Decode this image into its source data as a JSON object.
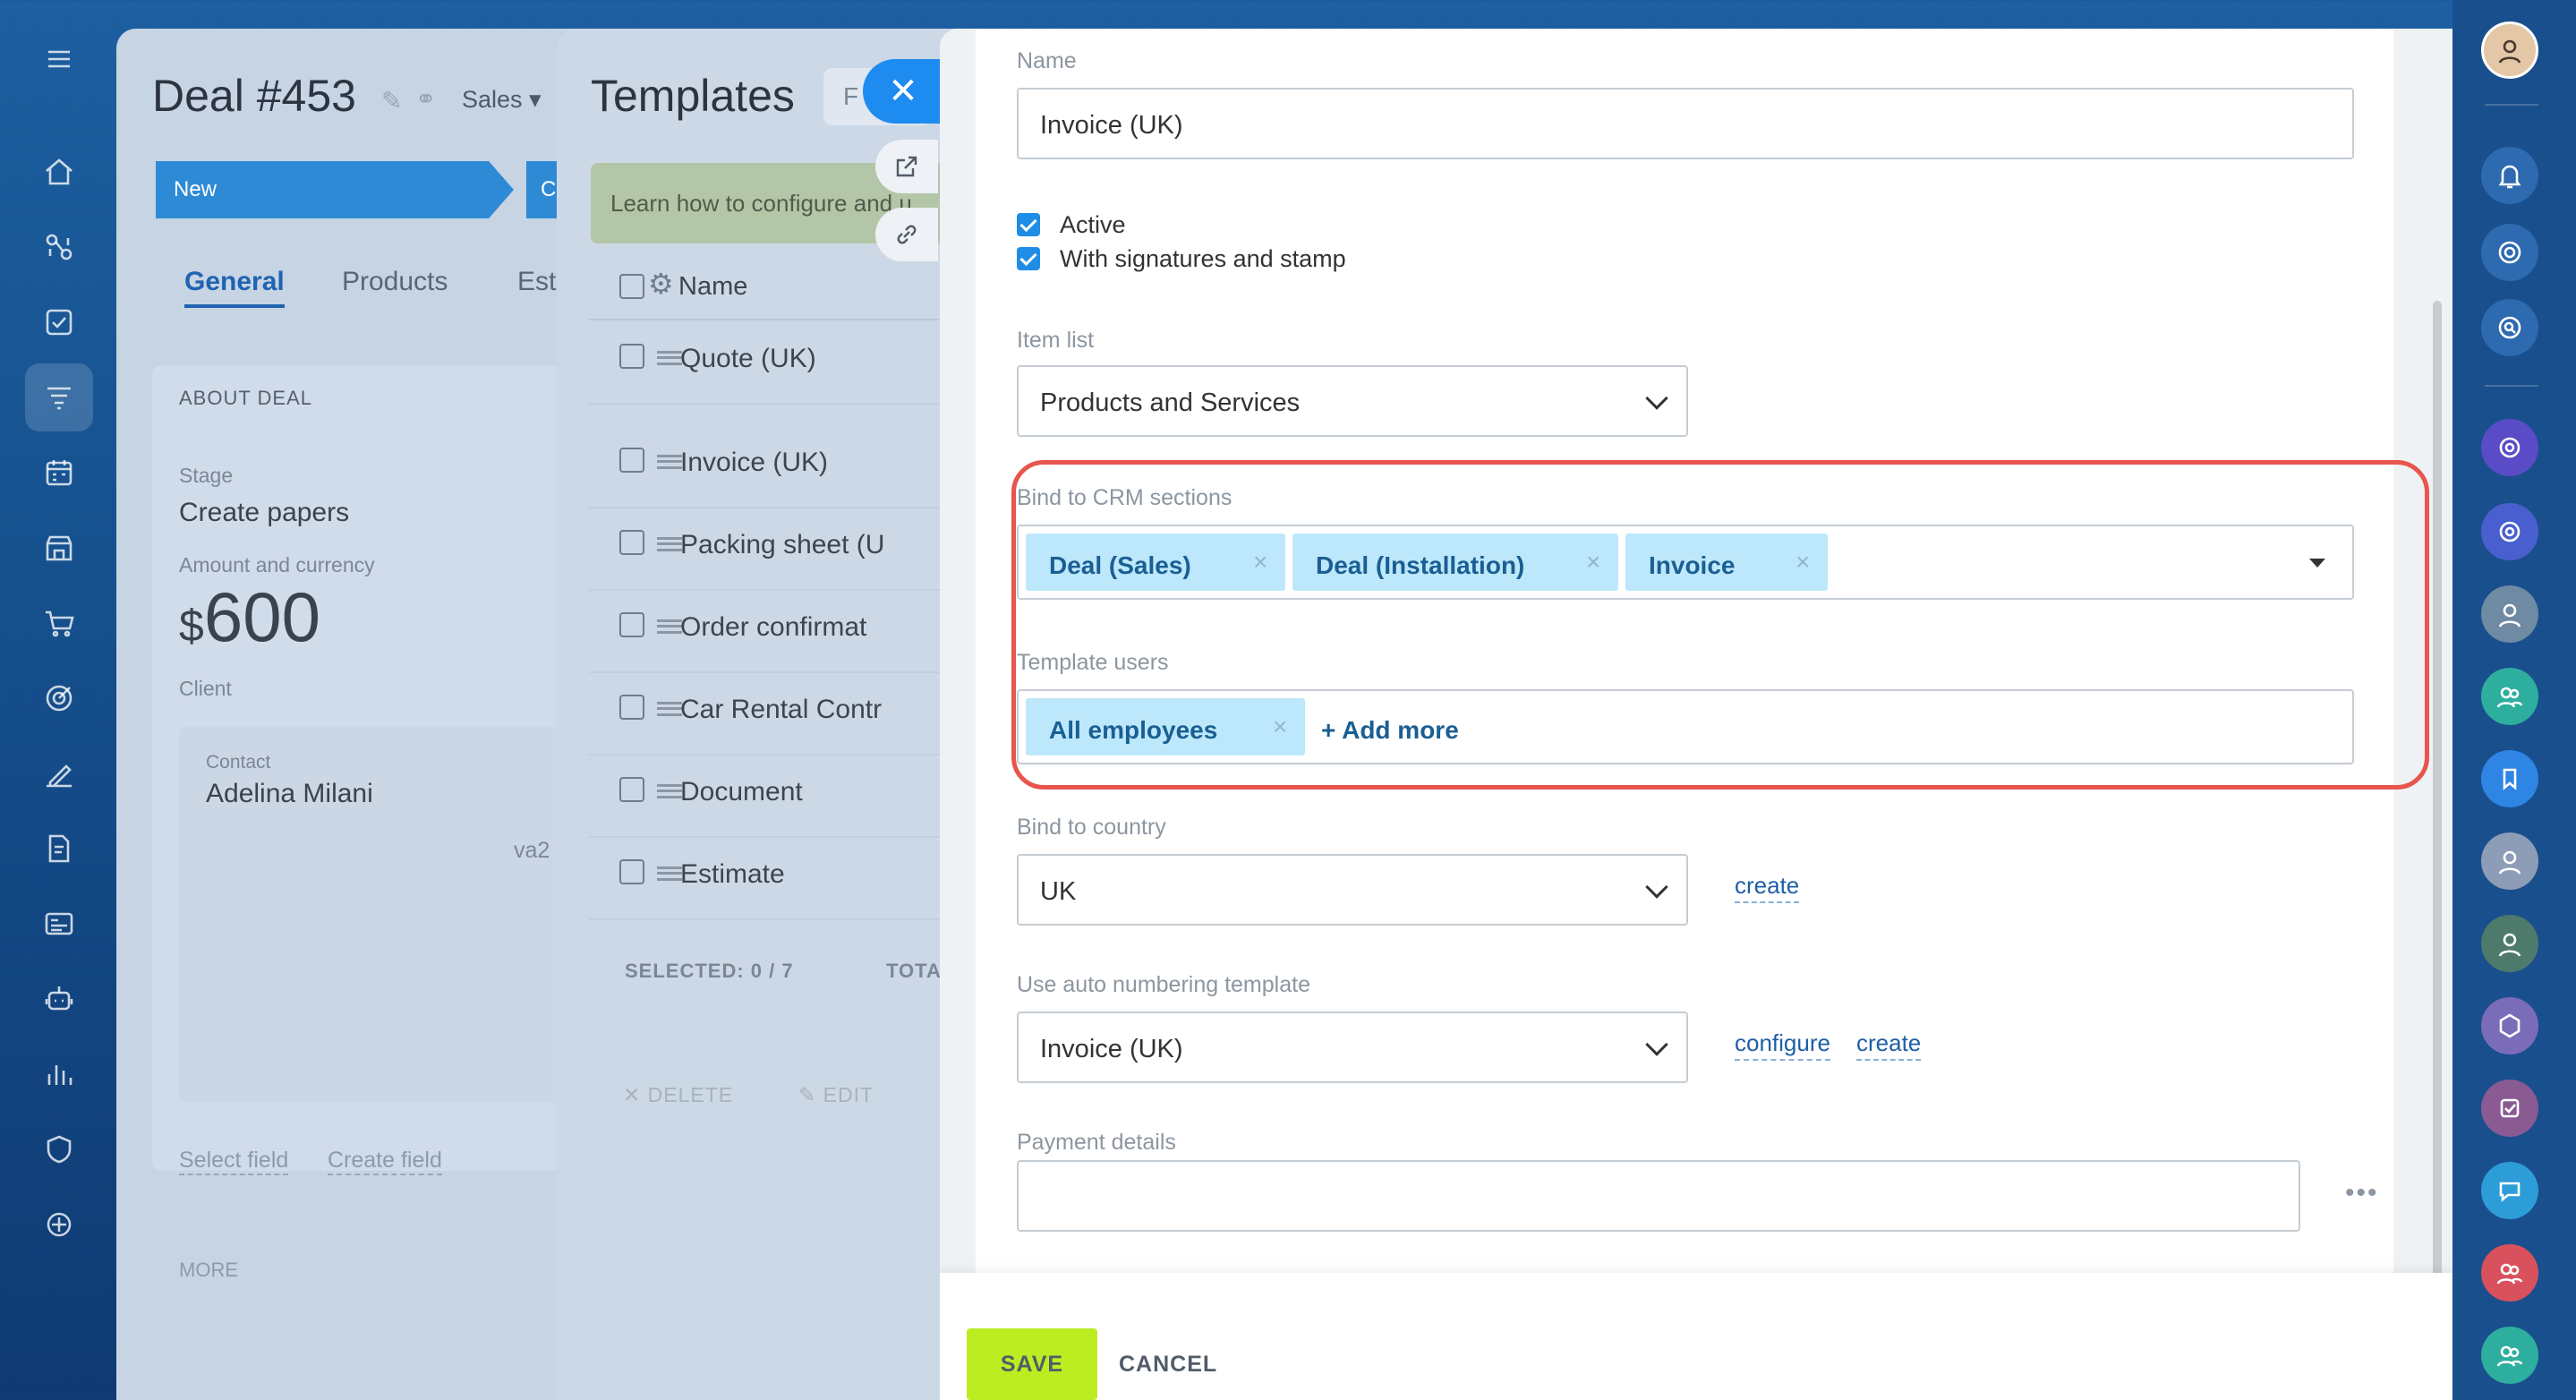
{
  "deal": {
    "title": "Deal #453",
    "pipeline": "Sales ▾",
    "stage_current": "New",
    "stage_next": "C",
    "tabs": [
      "General",
      "Products",
      "Est"
    ],
    "section": "ABOUT DEAL",
    "stage_label": "Stage",
    "stage_value": "Create papers",
    "amount_label": "Amount and currency",
    "amount_currency": "$",
    "amount_value": "600",
    "client_label": "Client",
    "contact_label": "Contact",
    "contact_name": "Adelina Milani",
    "contact_extra": "va2",
    "select_field": "Select field",
    "create_field": "Create field",
    "more": "MORE"
  },
  "templates": {
    "title": "Templates",
    "filter_placeholder": "F",
    "banner": "Learn how to configure and u",
    "col_name": "Name",
    "rows": [
      "Quote (UK)",
      "Invoice (UK)",
      "Packing sheet (U",
      "Order confirmat",
      "Car Rental Contr",
      "Document",
      "Estimate"
    ],
    "selected": "SELECTED: 0 / 7",
    "total": "TOTA",
    "delete": "✕  DELETE",
    "edit": "✎  EDIT"
  },
  "form": {
    "name_label": "Name",
    "name_value": "Invoice (UK)",
    "active_label": "Active",
    "signatures_label": "With signatures and stamp",
    "item_list_label": "Item list",
    "item_list_value": "Products and Services",
    "bind_crm_label": "Bind to CRM sections",
    "crm_tags": [
      "Deal (Sales)",
      "Deal (Installation)",
      "Invoice"
    ],
    "template_users_label": "Template users",
    "user_tags": [
      "All employees"
    ],
    "add_more": "+ Add more",
    "bind_country_label": "Bind to country",
    "country_value": "UK",
    "country_create": "create",
    "numbering_label": "Use auto numbering template",
    "numbering_value": "Invoice (UK)",
    "numbering_configure": "configure",
    "numbering_create": "create",
    "payment_label": "Payment details",
    "payment_value": "",
    "dots": "•••",
    "remove_glyph": "×",
    "close_glyph": "✕"
  },
  "footer": {
    "save": "SAVE",
    "cancel": "CANCEL"
  },
  "colors": {
    "highlight": "#e8554d",
    "save": "#bbed21",
    "tag_bg": "#bde8fb",
    "accent": "#1e8bf0"
  }
}
